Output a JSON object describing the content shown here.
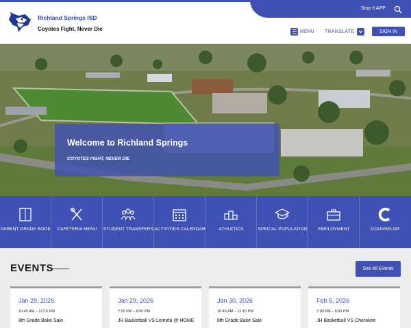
{
  "header": {
    "util_link": "Stop It APP",
    "district_name": "Richland Springs ISD",
    "motto": "Coyotes Fight, Never Die",
    "menu_label": "MENU",
    "translate_label": "TRANSLATE",
    "signin_label": "SIGN IN"
  },
  "hero": {
    "title": "Welcome to Richland Springs",
    "subtitle": "COYOTES FIGHT, NEVER DIE"
  },
  "quicklinks": [
    {
      "label": "PARENT GRADE BOOK",
      "icon": "book-icon"
    },
    {
      "label": "CAFETERIA MENU",
      "icon": "utensils-icon"
    },
    {
      "label": "STUDENT TRANSFERS",
      "icon": "people-icon"
    },
    {
      "label": "ACTIVITIES CALENDAR",
      "icon": "calendar-icon"
    },
    {
      "label": "ATHLETICS",
      "icon": "podium-icon"
    },
    {
      "label": "SPECIAL POPULATION",
      "icon": "graduation-cap-icon"
    },
    {
      "label": "EMPLOYMENT",
      "icon": "briefcase-icon"
    },
    {
      "label": "COUNSELOR",
      "icon": "counselor-c-icon"
    }
  ],
  "events": {
    "title": "EVENTS",
    "see_all_label": "See All Events",
    "items": [
      {
        "date": "Jan 29, 2026",
        "time": "10:45 AM – 12:15 PM",
        "name": "8th Grade Bake Sale"
      },
      {
        "date": "Jan 29, 2026",
        "time": "7:00 PM – 8:00 PM",
        "name": "JH Basketball VS Lometa @ HOME"
      },
      {
        "date": "Jan 30, 2026",
        "time": "10:45 AM – 12:15 PM",
        "name": "8th Grade Bake Sale"
      },
      {
        "date": "Feb 5, 2026",
        "time": "7:00 PM – 8:00 PM",
        "name": "JH Basketball VS Cherokee"
      }
    ]
  },
  "colors": {
    "brand_blue": "#3f51b5",
    "page_bg": "#ececec"
  }
}
